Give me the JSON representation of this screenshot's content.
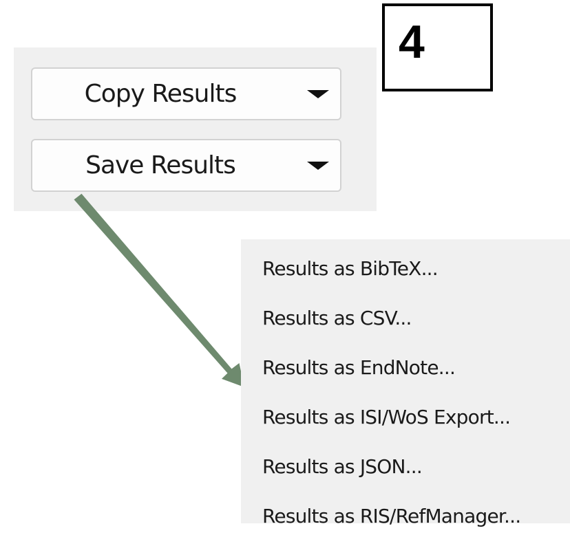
{
  "step_callout": {
    "number": "4"
  },
  "buttons": {
    "copy_results_label": "Copy Results",
    "save_results_label": "Save Results"
  },
  "save_menu": {
    "items": [
      {
        "label": "Results as BibTeX..."
      },
      {
        "label": "Results as CSV..."
      },
      {
        "label": "Results as EndNote..."
      },
      {
        "label": "Results as ISI/WoS Export..."
      },
      {
        "label": "Results as JSON..."
      },
      {
        "label": "Results as RIS/RefManager..."
      }
    ]
  },
  "icons": {
    "dropdown": "chevron-down-icon",
    "annotation": "arrow-icon"
  },
  "colors": {
    "panel_background": "#f0f0f0",
    "button_background": "#fdfdfd",
    "button_border": "#d2d2d2",
    "arrow": "#6e8a6e",
    "callout_border": "#000000"
  }
}
